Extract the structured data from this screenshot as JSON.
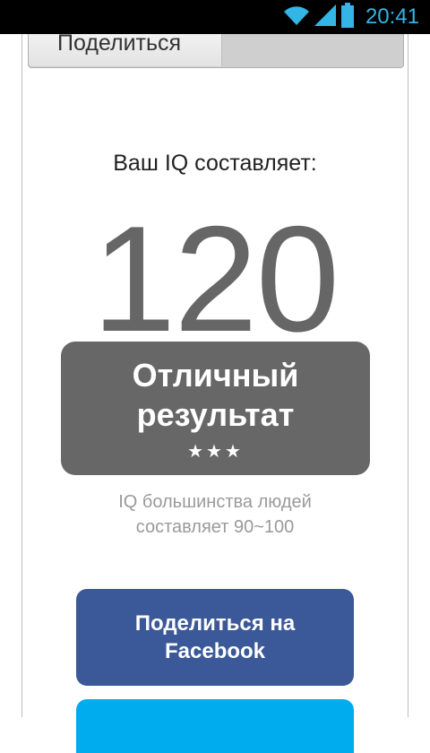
{
  "status_bar": {
    "time": "20:41",
    "icons": [
      "wifi-icon",
      "signal-icon",
      "battery-icon"
    ],
    "accent_color": "#33b5e5"
  },
  "tabs": {
    "share_label": "Поделиться"
  },
  "result": {
    "label": "Ваш IQ составляет:",
    "iq_value": "120",
    "rating_line1": "Отличный",
    "rating_line2": "результат",
    "stars": "★★★",
    "box_color": "#676767"
  },
  "note": {
    "line1": "IQ большинства людей",
    "line2": "составляет 90~100"
  },
  "buttons": {
    "facebook_line1": "Поделиться на",
    "facebook_line2": "Facebook",
    "facebook_color": "#3b5998",
    "twitter_color": "#00aced"
  }
}
